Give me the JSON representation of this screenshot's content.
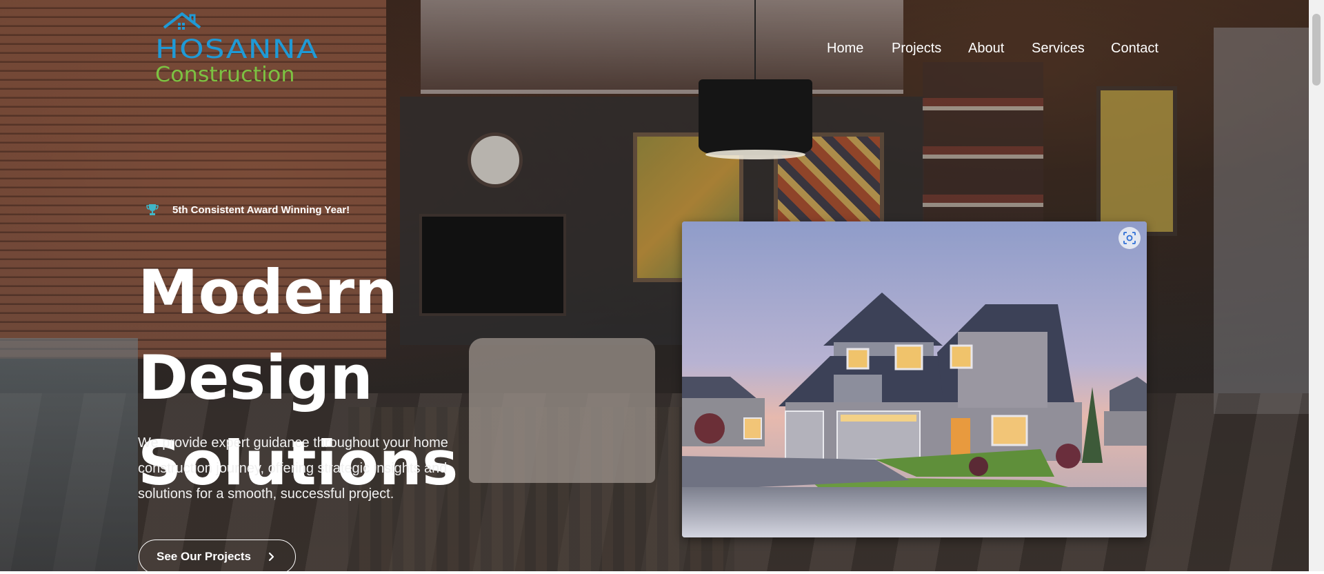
{
  "brand": {
    "name_line1": "HOSANNA",
    "name_line2": "Construction",
    "color_primary": "#1f9ad6",
    "color_secondary": "#7cc242"
  },
  "nav": {
    "items": [
      {
        "label": "Home"
      },
      {
        "label": "Projects"
      },
      {
        "label": "About"
      },
      {
        "label": "Services"
      },
      {
        "label": "Contact"
      }
    ]
  },
  "hero": {
    "award_icon": "trophy-icon",
    "award_text": "5th Consistent Award Winning Year!",
    "headline_line1": "Modern Design",
    "headline_line2": "Solutions",
    "description": "We provide expert guidance throughout your home construction journey, offering strategic insights and solutions for a smooth, successful project.",
    "cta_label": "See Our Projects",
    "cta_icon": "chevron-right-icon",
    "image_alt": "Modern two-story house with garage at dusk",
    "image_action_icon": "visual-search-icon"
  }
}
